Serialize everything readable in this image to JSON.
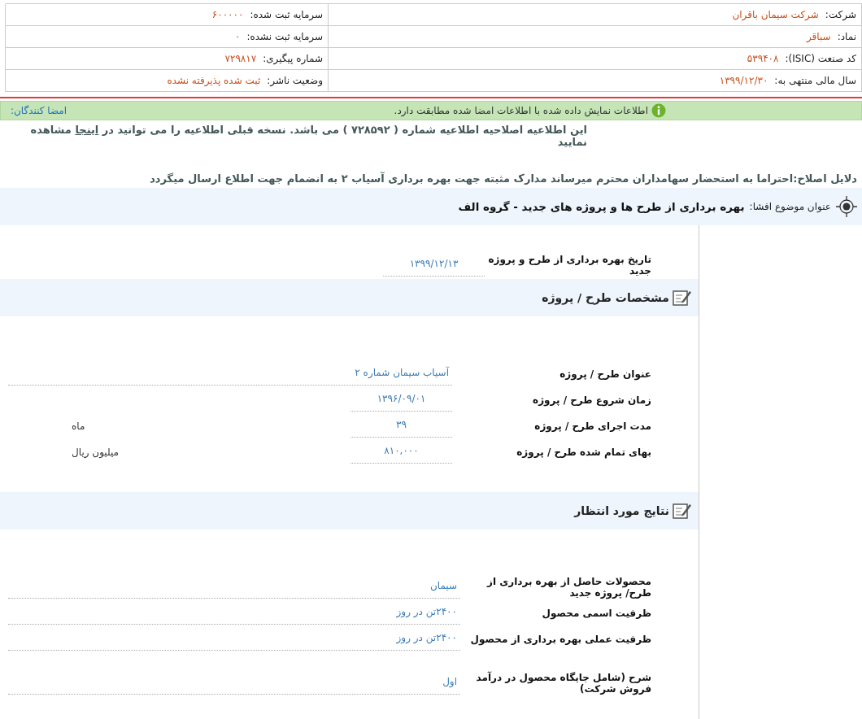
{
  "company_info": {
    "rows": [
      {
        "right": {
          "label": "شرکت:",
          "value": "شرکت سیمان باقران"
        },
        "left": {
          "label": "سرمایه ثبت شده:",
          "value": "۶۰۰۰۰۰"
        }
      },
      {
        "right": {
          "label": "نماد:",
          "value": "سباقر"
        },
        "left": {
          "label": "سرمایه ثبت نشده:",
          "value": "۰"
        }
      },
      {
        "right": {
          "label": "کد صنعت (ISIC):",
          "value": "۵۳۹۴۰۸"
        },
        "left": {
          "label": "شماره پیگیری:",
          "value": "۷۲۹۸۱۷"
        }
      },
      {
        "right": {
          "label": "سال مالی منتهی به:",
          "value": "۱۳۹۹/۱۲/۳۰"
        },
        "left": {
          "label": "وضعیت ناشر:",
          "value": "ثبت شده پذیرفته نشده"
        }
      }
    ]
  },
  "verification": {
    "message": "اطلاعات نمایش داده شده با اطلاعات امضا شده مطابقت دارد.",
    "signers_label": "امضا کنندگان:"
  },
  "notice": {
    "before": "این اطلاعیه اصلاحیه اطلاعیه شماره ( ۷۲۸۵۹۲ ) می باشد. نسخه قبلی اطلاعیه را می توانید در",
    "link": "اینجا",
    "after": "مشاهده نمایید"
  },
  "correction_reasons": "دلایل اصلاح:احتراما به استحضار سهامداران محترم میرساند مدارک مثبته جهت بهره برداری آسیاب ۲ به انضمام جهت اطلاع ارسال میگردد",
  "subject": {
    "label": "عنوان موضوع افشا:",
    "title": "بهره برداری از طرح ها و پروژه های جدید - گروه الف"
  },
  "operation_date": {
    "label": "تاریخ بهره برداری از طرح و پروژه جدید",
    "value": "۱۳۹۹/۱۲/۱۳"
  },
  "sections": [
    {
      "title": "مشخصات طرح / پروژه",
      "fields": [
        {
          "kind": "wide",
          "label": "عنوان طرح / پروژه",
          "value": "آسیاب سیمان شماره ۲"
        },
        {
          "kind": "short",
          "label": "زمان شروع طرح / پروژه",
          "value": "۱۳۹۶/۰۹/۰۱"
        },
        {
          "kind": "short",
          "label": "مدت اجرای طرح / پروژه",
          "value": "۳۹",
          "unit": "ماه"
        },
        {
          "kind": "short",
          "label": "بهای تمام شده طرح / پروژه",
          "value": "۸۱۰,۰۰۰",
          "unit": "میلیون ریال"
        }
      ]
    },
    {
      "title": "نتایج مورد انتظار",
      "fields": [
        {
          "kind": "wide",
          "label": "محصولات حاصل از بهره برداری از طرح/ پروژه جدید",
          "value": "سیمان"
        },
        {
          "kind": "wide",
          "label": "ظرفیت اسمی محصول",
          "value": "۲۴۰۰تن در روز"
        },
        {
          "kind": "wide",
          "label": "ظرفیت عملی بهره برداری از محصول",
          "value": "۲۴۰۰تن در روز"
        },
        {
          "kind": "spaced",
          "label": "شرح (شامل جایگاه محصول در درآمد فروش شرکت)",
          "value": "اول"
        }
      ]
    }
  ]
}
